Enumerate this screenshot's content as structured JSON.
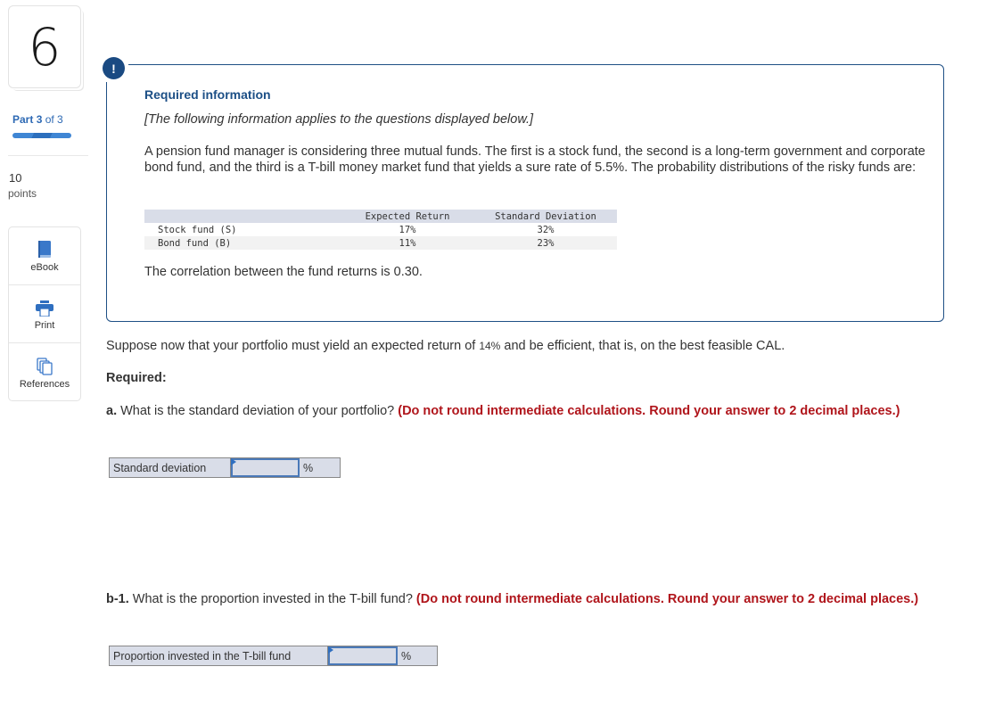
{
  "sidebar": {
    "question_number": "6",
    "part": {
      "prefix": "Part",
      "current": "3",
      "of_text": "of 3",
      "progress": 1.0
    },
    "points": {
      "value": "10",
      "label": "points"
    },
    "tools": [
      {
        "label": "eBook",
        "icon": "book-icon"
      },
      {
        "label": "Print",
        "icon": "printer-icon"
      },
      {
        "label": "References",
        "icon": "references-icon"
      }
    ]
  },
  "info": {
    "alert_icon": "!",
    "title": "Required information",
    "note": "[The following information applies to the questions displayed below.]",
    "intro": "A pension fund manager is considering three mutual funds. The first is a stock fund, the second is a long-term government and corporate bond fund, and the third is a T-bill money market fund that yields a sure rate of 5.5%. The probability distributions of the risky funds are:",
    "table": {
      "headers": [
        "",
        "Expected Return",
        "Standard Deviation"
      ],
      "rows": [
        {
          "name": "Stock fund (S)",
          "expected_return": "17%",
          "std_dev": "32%"
        },
        {
          "name": "Bond fund (B)",
          "expected_return": "11%",
          "std_dev": "23%"
        }
      ]
    },
    "correlation": "The correlation between the fund returns is 0.30."
  },
  "question": {
    "suppose_pre": "Suppose now that your portfolio must yield an expected return of ",
    "suppose_value": "14%",
    "suppose_post": " and be efficient, that is, on the best feasible CAL.",
    "required_label": "Required:",
    "parts": [
      {
        "id": "a.",
        "text": " What is the standard deviation of your portfolio? ",
        "instruction": "(Do not round intermediate calculations. Round your answer to 2 decimal places.)",
        "answer_label": "Standard deviation",
        "answer_value": "",
        "unit": "%"
      },
      {
        "id": "b-1.",
        "text": " What is the proportion invested in the T-bill fund? ",
        "instruction": "(Do not round intermediate calculations. Round your answer to 2 decimal places.)",
        "answer_label": "Proportion invested in the T-bill fund",
        "answer_value": "",
        "unit": "%"
      }
    ]
  }
}
